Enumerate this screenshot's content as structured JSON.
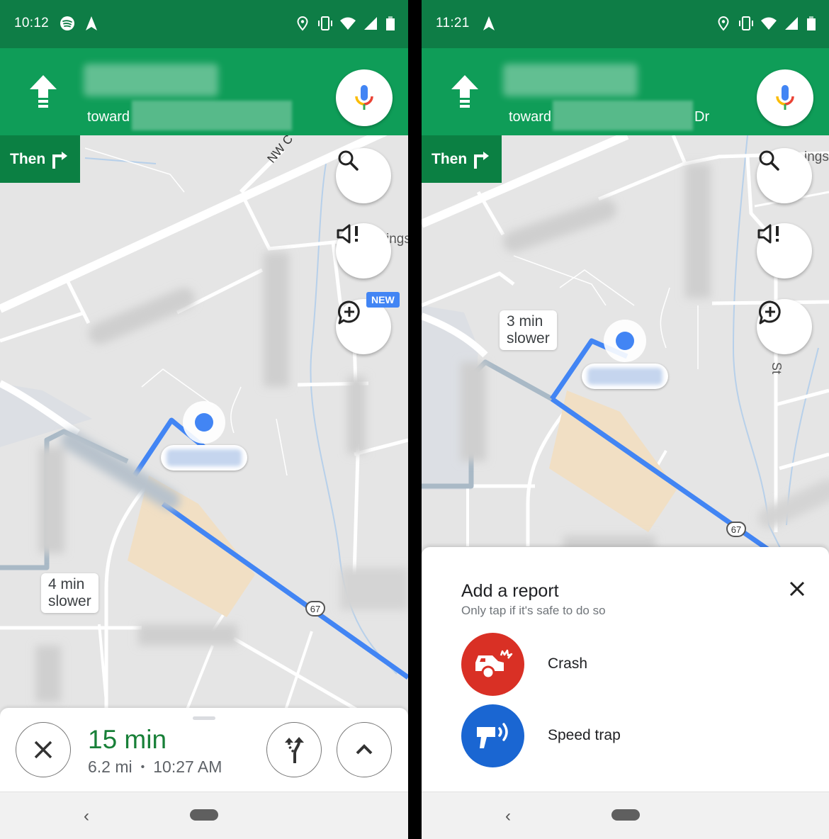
{
  "colors": {
    "status_bar": "#0e7d46",
    "nav_header": "#0f9d58",
    "then_box": "#0b8043",
    "route": "#4285f4",
    "alt_route": "#a9b9c6",
    "eta_green": "#188038",
    "crash_red": "#d93025",
    "speedtrap_blue": "#1a66d2",
    "new_badge": "#4285f4"
  },
  "left": {
    "status": {
      "time": "10:12",
      "left_icons": [
        "spotify-icon",
        "navigation-arrow-icon"
      ],
      "right_icons": [
        "location-pin-icon",
        "vibrate-icon",
        "wifi-icon",
        "signal-icon",
        "battery-icon"
      ]
    },
    "header": {
      "maneuver_icon": "straight-arrow-icon",
      "street": "(blurred)",
      "toward_label": "toward",
      "toward_suffix": ""
    },
    "then": {
      "label": "Then",
      "icon": "turn-right-icon"
    },
    "fabs": [
      {
        "name": "search",
        "icon": "search-icon"
      },
      {
        "name": "sound-alerts",
        "icon": "volume-alert-icon"
      },
      {
        "name": "add-report",
        "icon": "add-report-icon",
        "badge": "NEW"
      }
    ],
    "map": {
      "road_label_nw": "NW C",
      "road_label_ings": "ings",
      "alt_route_callout": [
        "4 min",
        "slower"
      ],
      "route_shield": "67"
    },
    "bottom": {
      "eta": "15 min",
      "distance": "6.2 mi",
      "separator": "•",
      "arrival": "10:27 AM",
      "close_icon": "close-icon",
      "alt_routes_icon": "alternate-routes-icon",
      "expand_icon": "chevron-up-icon"
    },
    "navbar": {
      "back": "‹"
    }
  },
  "right": {
    "status": {
      "time": "11:21",
      "left_icons": [
        "navigation-arrow-icon"
      ],
      "right_icons": [
        "location-pin-icon",
        "vibrate-icon",
        "wifi-icon",
        "signal-icon",
        "battery-icon"
      ]
    },
    "header": {
      "maneuver_icon": "straight-arrow-icon",
      "street": "(blurred)",
      "toward_label": "toward",
      "toward_suffix": "Dr"
    },
    "then": {
      "label": "Then",
      "icon": "turn-right-icon"
    },
    "fabs": [
      {
        "name": "search",
        "icon": "search-icon"
      },
      {
        "name": "sound-alerts",
        "icon": "volume-alert-icon"
      },
      {
        "name": "add-report",
        "icon": "add-report-icon"
      }
    ],
    "map": {
      "road_label_ings": "ings",
      "road_label_st": "St",
      "alt_route_callout": [
        "3 min",
        "slower"
      ],
      "route_shield": "67"
    },
    "report": {
      "title": "Add a report",
      "subtitle": "Only tap if it's safe to do so",
      "items": [
        {
          "label": "Crash",
          "icon": "crash-icon"
        },
        {
          "label": "Speed trap",
          "icon": "speed-trap-icon"
        }
      ]
    },
    "navbar": {
      "back": "‹"
    }
  }
}
